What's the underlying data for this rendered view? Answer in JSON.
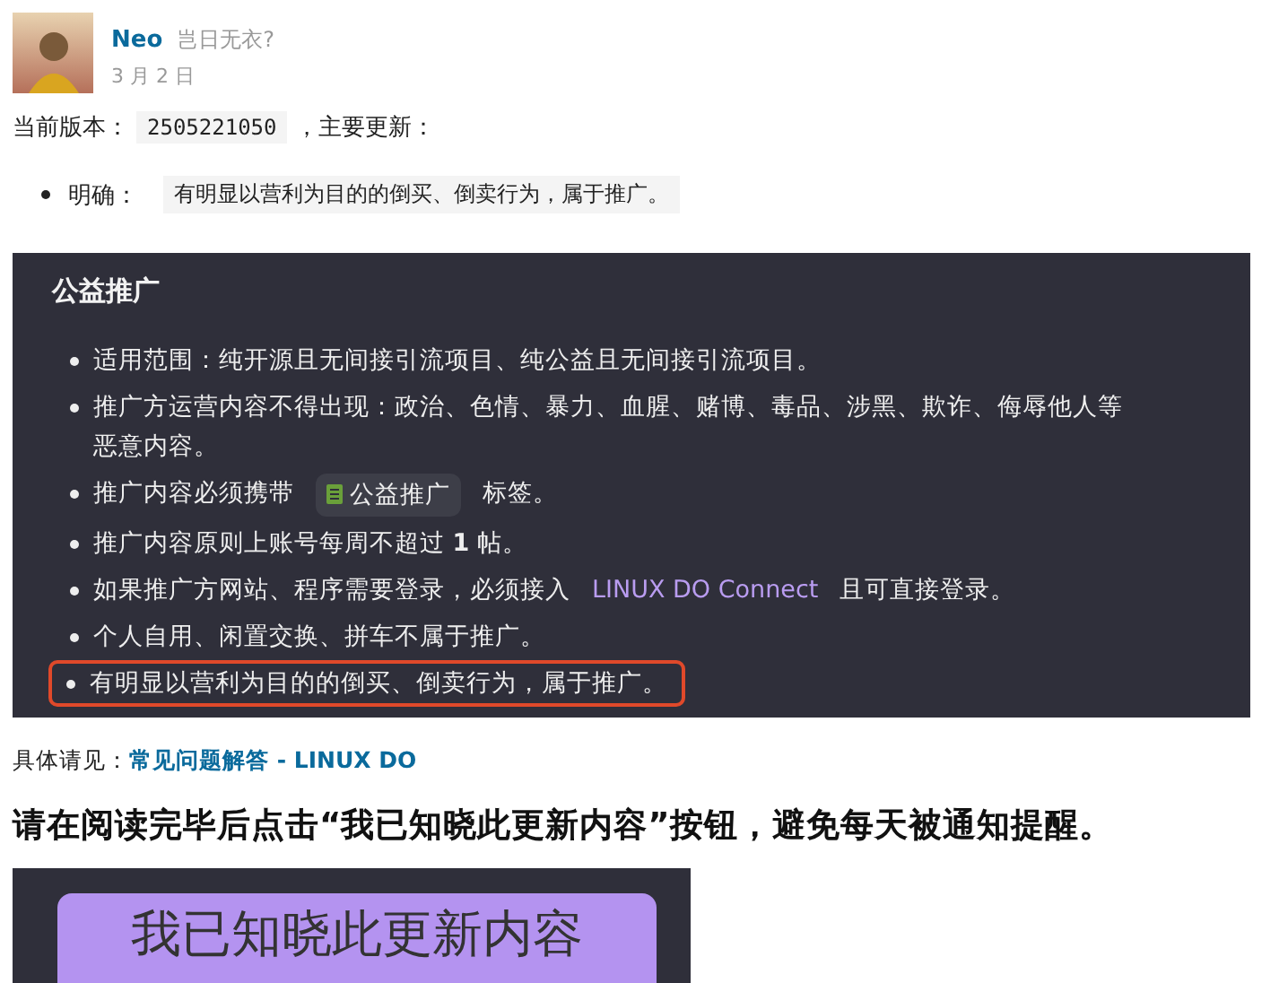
{
  "post": {
    "author": "Neo",
    "user_title": "岂日无衣?",
    "date": "3 月 2 日"
  },
  "version_line": {
    "label": "当前版本：",
    "version": "2505221050",
    "after": "，主要更新："
  },
  "updates": [
    {
      "label": "明确：",
      "code": "有明显以营利为目的的倒买、倒卖行为，属于推广。"
    }
  ],
  "rules_screenshot": {
    "heading": "公益推广",
    "items": [
      {
        "kind": "text",
        "text": "适用范围：纯开源且无间接引流项目、纯公益且无间接引流项目。",
        "highlighted": false
      },
      {
        "kind": "text",
        "text": "推广方运营内容不得出现：政治、色情、暴力、血腥、赌博、毒品、涉黑、欺诈、侮辱他人等恶意内容。",
        "highlighted": false
      },
      {
        "kind": "tag",
        "text": "推广内容必须携带",
        "tag": "公益推广",
        "after": "标签。",
        "highlighted": false
      },
      {
        "kind": "text",
        "text": "推广内容原则上账号每周不超过 **1** 帖。",
        "highlighted": false
      },
      {
        "kind": "link",
        "text": "如果推广方网站、程序需要登录，必须接入",
        "link": "LINUX DO Connect",
        "after": "且可直接登录。",
        "highlighted": false
      },
      {
        "kind": "text",
        "text": "个人自用、闲置交换、拼车不属于推广。",
        "highlighted": false
      },
      {
        "kind": "text",
        "text": "有明显以营利为目的的倒买、倒卖行为，属于推广。",
        "highlighted": true
      }
    ]
  },
  "details": {
    "label": "具体请见：",
    "link": "常见问题解答 - LINUX DO"
  },
  "notice": "请在阅读完毕后点击“我已知晓此更新内容”按钮，避免每天被通知提醒。",
  "button_screenshot": {
    "button": "我已知晓此更新内容"
  }
}
